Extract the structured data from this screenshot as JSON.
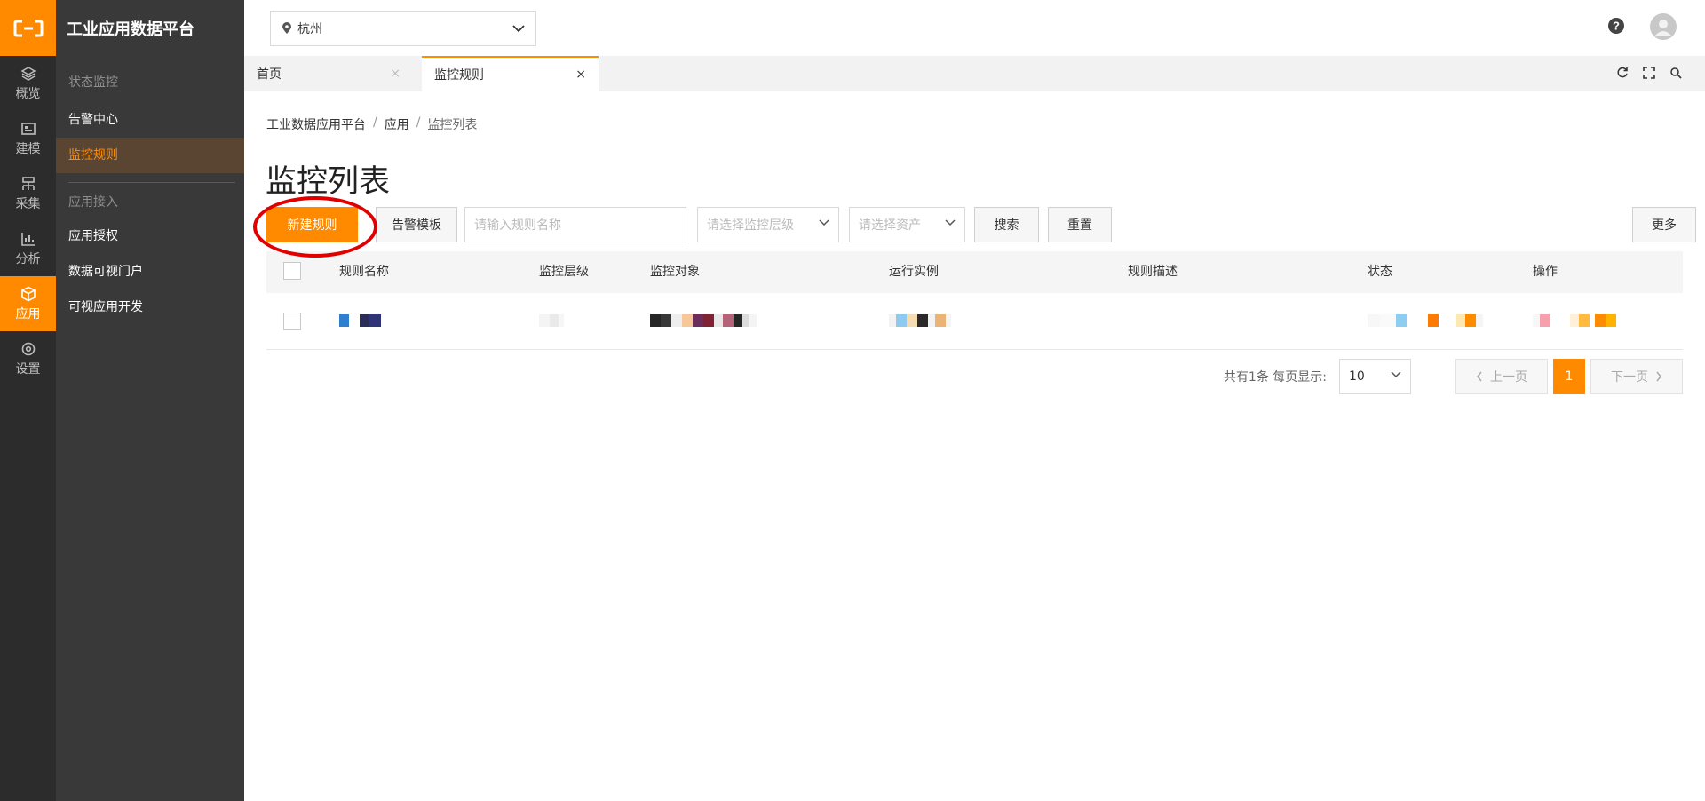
{
  "app": {
    "brand": "工业应用数据平台"
  },
  "rail": [
    {
      "label": "概览",
      "icon": "layers-icon"
    },
    {
      "label": "建模",
      "icon": "model-icon"
    },
    {
      "label": "采集",
      "icon": "collect-icon"
    },
    {
      "label": "分析",
      "icon": "chart-icon"
    },
    {
      "label": "应用",
      "icon": "cube-icon",
      "active": true
    },
    {
      "label": "设置",
      "icon": "gear-icon"
    }
  ],
  "submenu": {
    "group1": "状态监控",
    "items1": [
      "告警中心",
      "监控规则"
    ],
    "group2": "应用接入",
    "items2": [
      "应用授权",
      "数据可视门户",
      "可视应用开发"
    ]
  },
  "header": {
    "city": "杭州"
  },
  "tabs": [
    {
      "label": "首页",
      "close": "×"
    },
    {
      "label": "监控规则",
      "close": "×"
    }
  ],
  "breadcrumb": [
    "工业数据应用平台",
    "应用",
    "监控列表"
  ],
  "breadcrumb_sep": "/",
  "page": {
    "title": "监控列表"
  },
  "toolbar": {
    "new_rule": "新建规则",
    "alert_template": "告警模板",
    "name_placeholder": "请输入规则名称",
    "level_placeholder": "请选择监控层级",
    "asset_placeholder": "请选择资产",
    "search": "搜索",
    "reset": "重置",
    "more": "更多"
  },
  "table": {
    "columns": [
      "规则名称",
      "监控层级",
      "监控对象",
      "运行实例",
      "规则描述",
      "状态",
      "操作"
    ]
  },
  "pagination": {
    "summary": "共有1条 每页显示:",
    "page_size": "10",
    "prev": "上一页",
    "current": "1",
    "next": "下一页"
  },
  "colors": {
    "accent": "#ff8a00",
    "sidebar": "#2c2c2c",
    "submenu": "#393939",
    "annotation": "#e10000"
  }
}
